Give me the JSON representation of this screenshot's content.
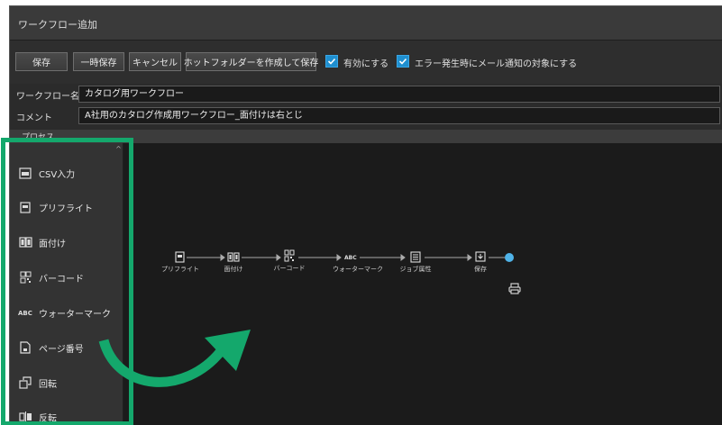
{
  "window": {
    "title": "ワークフロー追加"
  },
  "toolbar": {
    "save": "保存",
    "temp_save": "一時保存",
    "cancel": "キャンセル",
    "hotfolder_save": "ホットフォルダーを作成して保存",
    "enable_label": "有効にする",
    "notify_label": "エラー発生時にメール通知の対象にする"
  },
  "form": {
    "name_label": "ワークフロー名",
    "name_value": "カタログ用ワークフロー",
    "comment_label": "コメント",
    "comment_value": "A社用のカタログ作成用ワークフロー_面付けは右とじ"
  },
  "process": {
    "header": "プロセス",
    "palette": [
      {
        "label": "CSV入力",
        "icon": "csv-icon"
      },
      {
        "label": "プリフライト",
        "icon": "preflight-icon"
      },
      {
        "label": "面付け",
        "icon": "imposition-icon"
      },
      {
        "label": "バーコード",
        "icon": "barcode-icon"
      },
      {
        "label": "ウォーターマーク",
        "icon": "watermark-icon"
      },
      {
        "label": "ページ番号",
        "icon": "page-number-icon"
      },
      {
        "label": "回転",
        "icon": "rotate-icon"
      },
      {
        "label": "反転",
        "icon": "flip-icon"
      }
    ],
    "flow": [
      {
        "label": "プリフライト",
        "icon": "preflight-icon"
      },
      {
        "label": "面付け",
        "icon": "imposition-icon"
      },
      {
        "label": "バーコード",
        "icon": "barcode-icon"
      },
      {
        "label": "ウォーターマーク",
        "icon": "watermark-icon"
      },
      {
        "label": "ジョブ属性",
        "icon": "job-attribute-icon"
      },
      {
        "label": "保存",
        "icon": "save-icon"
      }
    ]
  },
  "colors": {
    "accent": "#14a86c",
    "checkbox": "#1e8fd0",
    "flow_end": "#4fb3e8"
  }
}
